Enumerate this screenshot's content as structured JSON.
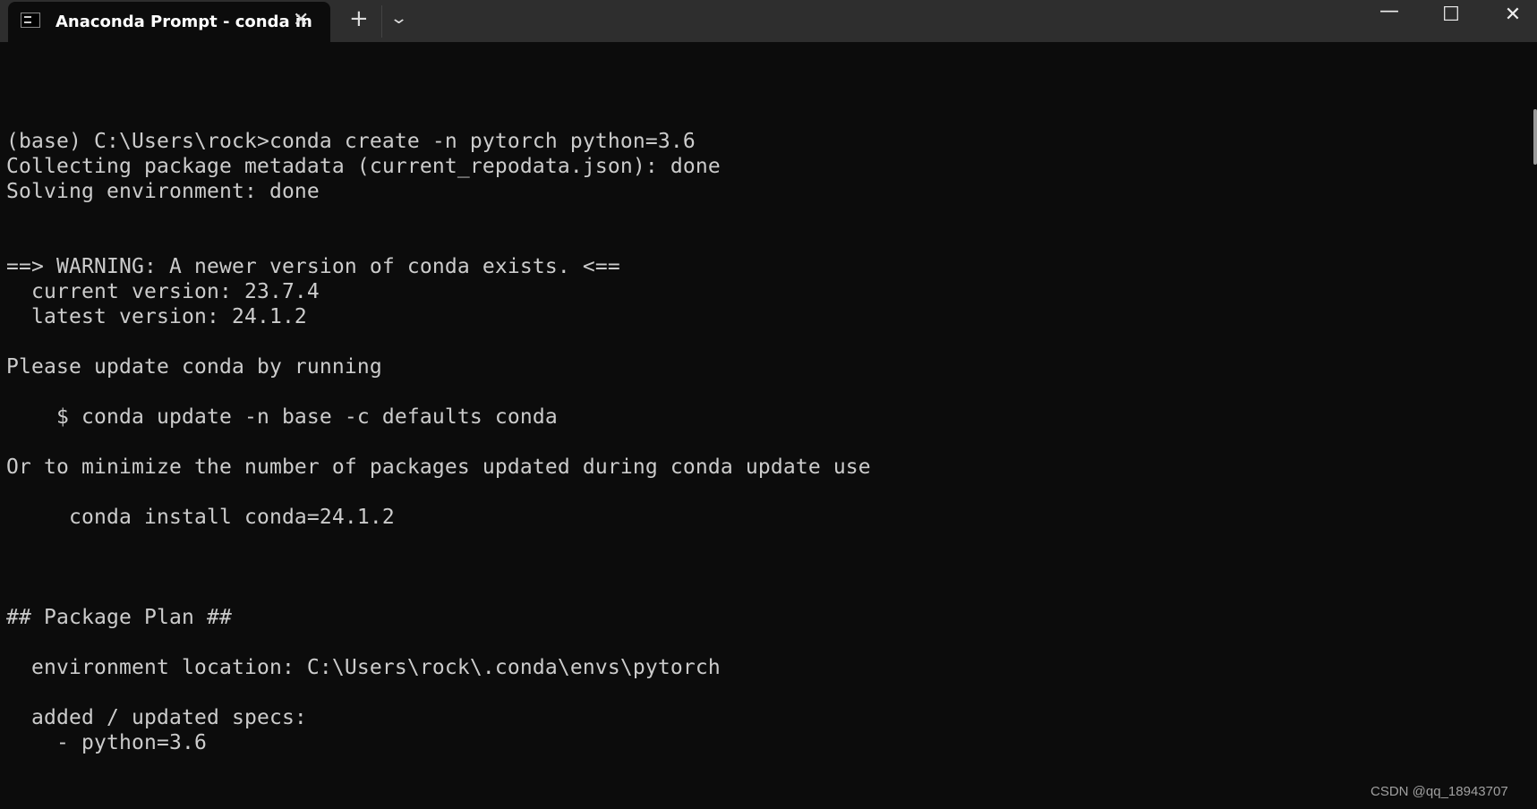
{
  "window": {
    "tab_title": "Anaconda Prompt - conda  in",
    "tab_icon": "terminal-icon",
    "new_tab": "+",
    "dropdown": "⌄",
    "minimize": "—",
    "maximize": "☐",
    "close": "✕",
    "tab_close": "✕"
  },
  "terminal": {
    "lines": [
      "",
      "",
      "",
      "(base) C:\\Users\\rock>conda create -n pytorch python=3.6",
      "Collecting package metadata (current_repodata.json): done",
      "Solving environment: done",
      "",
      "",
      "==> WARNING: A newer version of conda exists. <==",
      "  current version: 23.7.4",
      "  latest version: 24.1.2",
      "",
      "Please update conda by running",
      "",
      "    $ conda update -n base -c defaults conda",
      "",
      "Or to minimize the number of packages updated during conda update use",
      "",
      "     conda install conda=24.1.2",
      "",
      "",
      "",
      "## Package Plan ##",
      "",
      "  environment location: C:\\Users\\rock\\.conda\\envs\\pytorch",
      "",
      "  added / updated specs:",
      "    - python=3.6"
    ]
  },
  "watermark": "CSDN @qq_18943707"
}
